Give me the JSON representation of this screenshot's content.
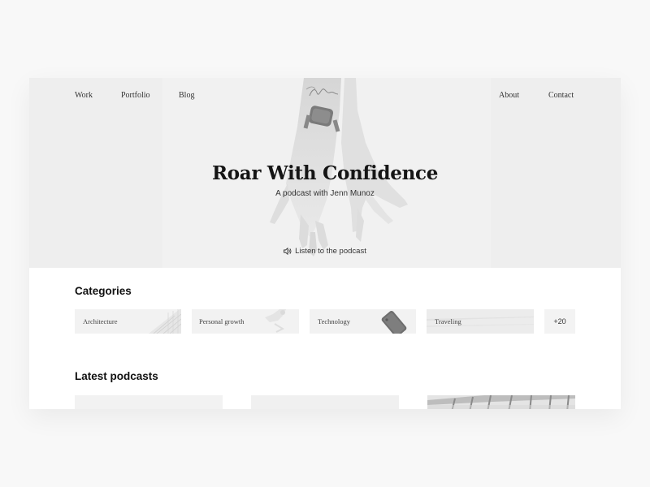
{
  "nav": {
    "left": [
      "Work",
      "Portfolio",
      "Blog"
    ],
    "right": [
      "About",
      "Contact"
    ]
  },
  "hero": {
    "title": "Roar With Confidence",
    "subtitle": "A podcast with Jenn Munoz",
    "listen_label": "Listen to the podcast",
    "listen_icon": "speaker-icon"
  },
  "categories": {
    "title": "Categories",
    "items": [
      "Architecture",
      "Personal growth",
      "Technology",
      "Traveling"
    ],
    "more_label": "+20"
  },
  "latest": {
    "title": "Latest podcasts"
  },
  "colors": {
    "page_bg": "#f8f8f8",
    "hero_bg": "#eeeeee",
    "text": "#151515"
  }
}
